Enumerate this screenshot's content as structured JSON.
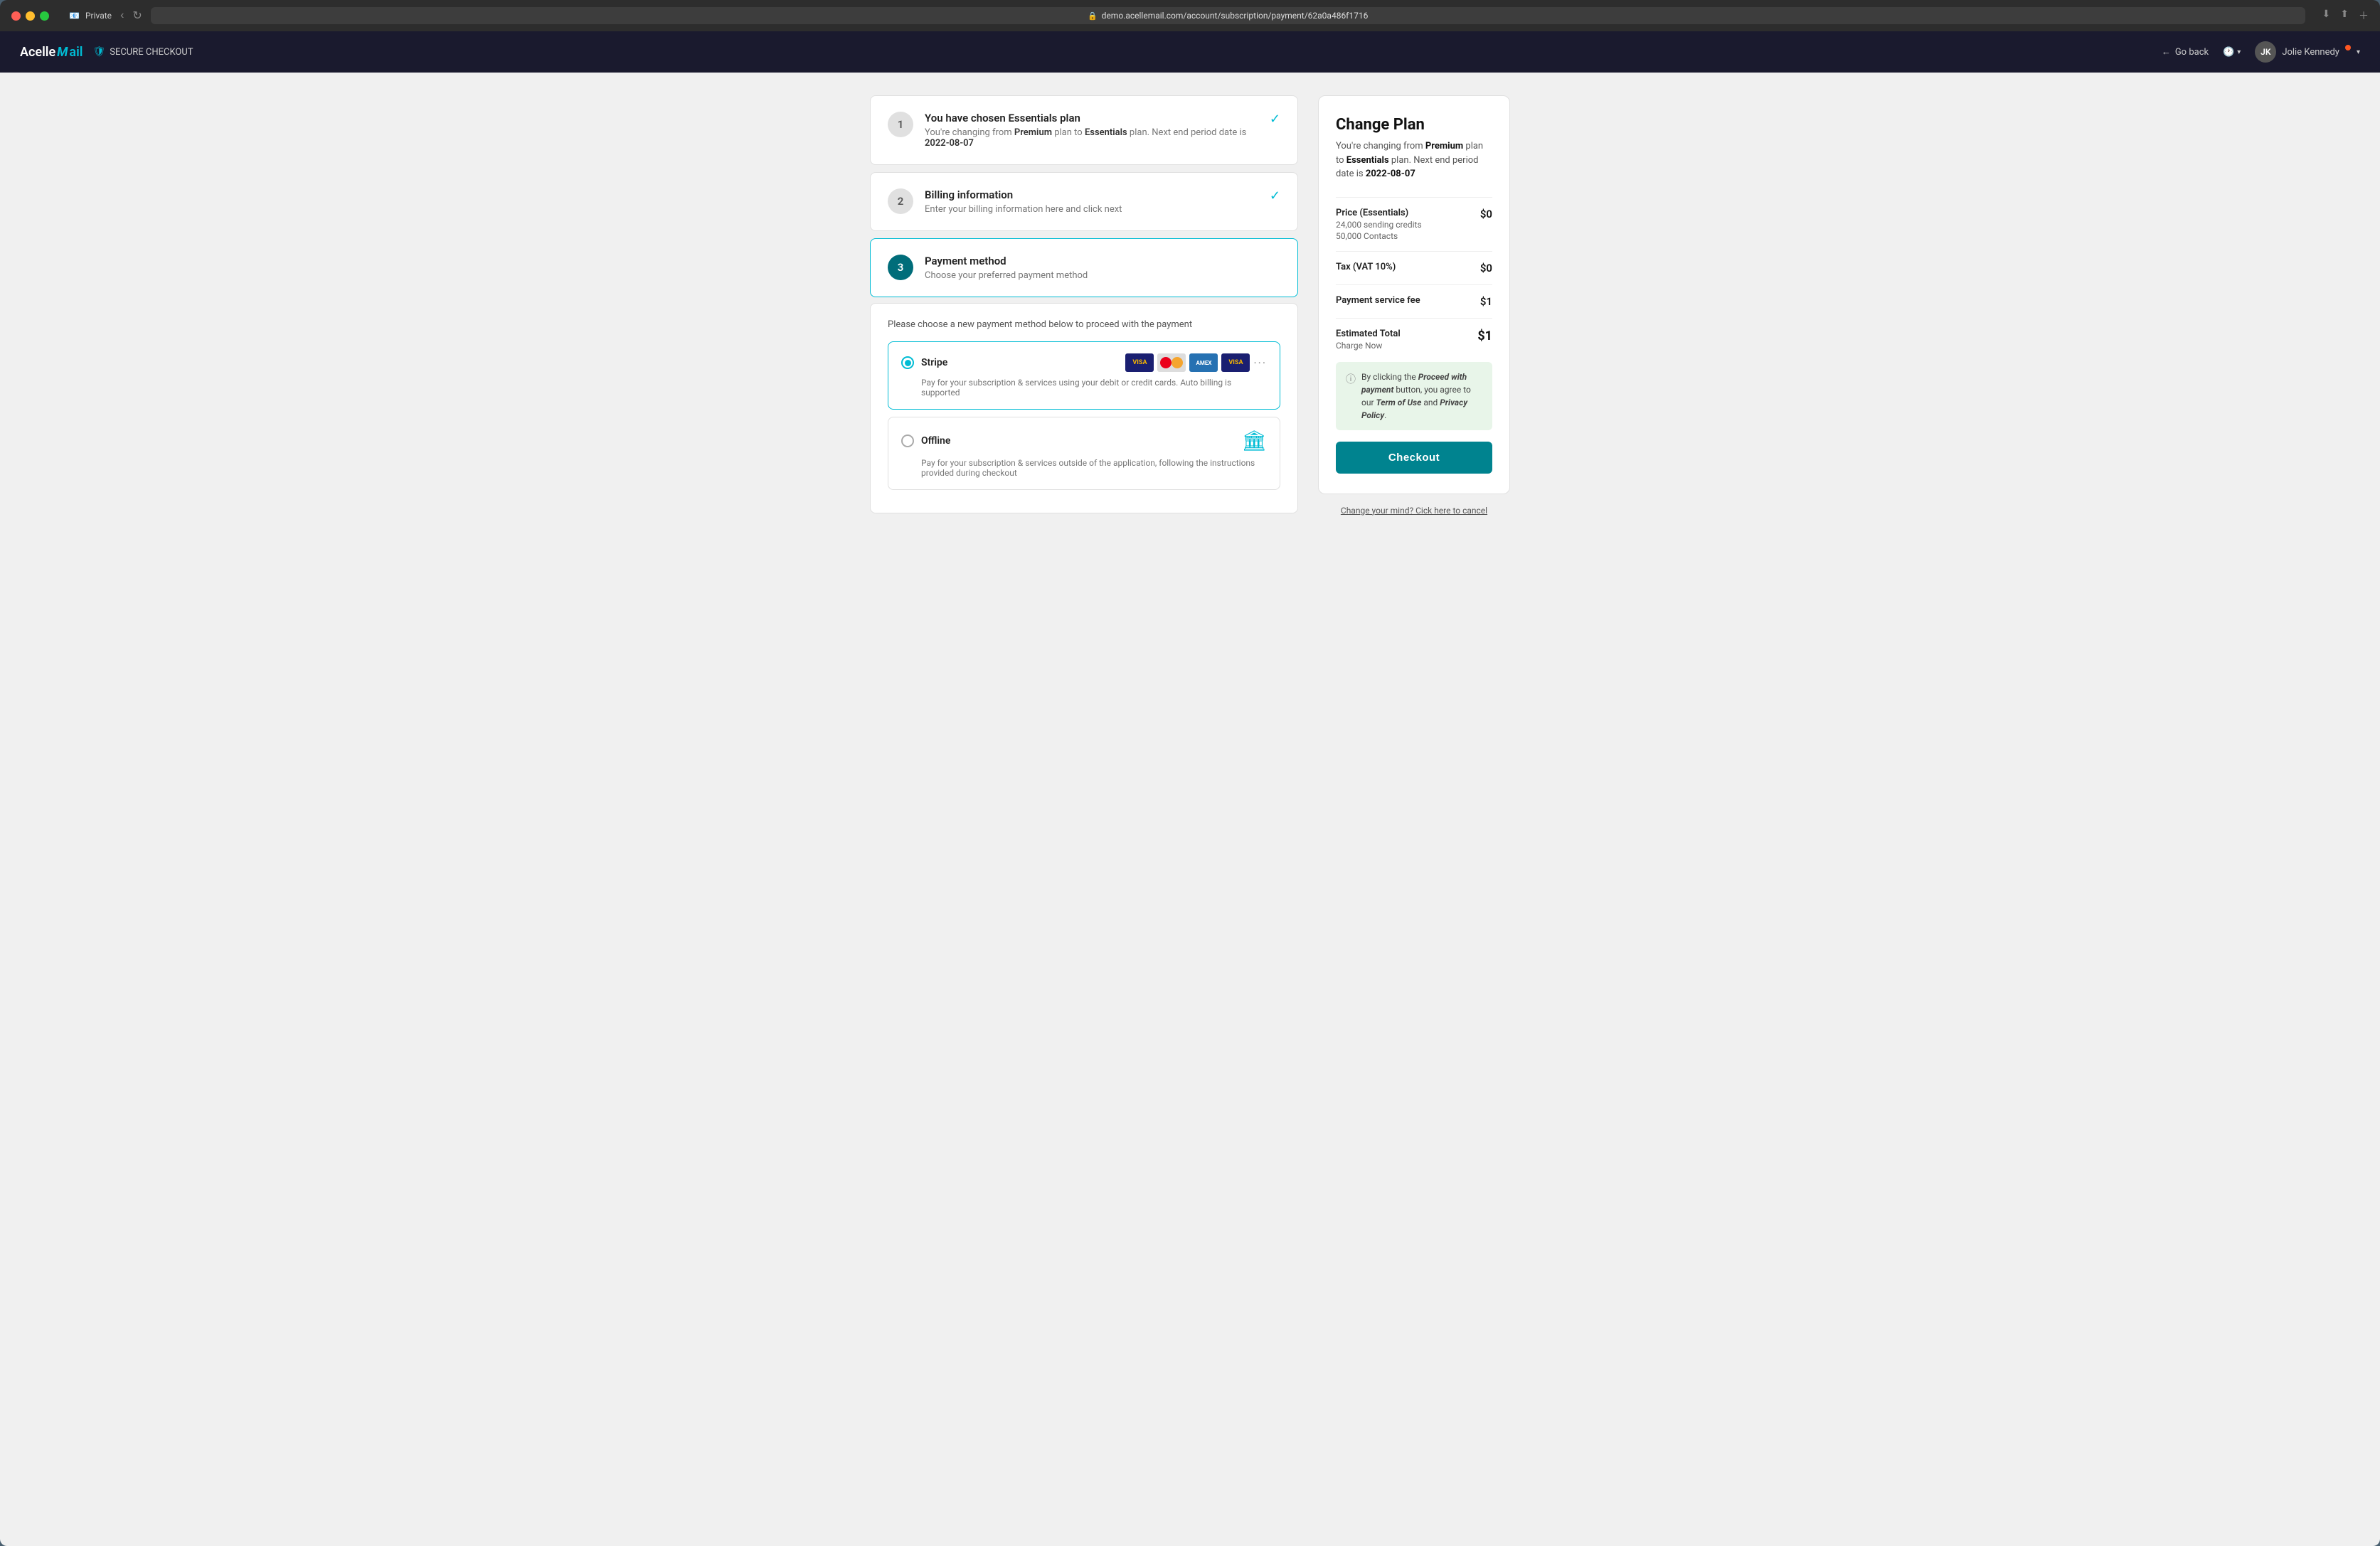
{
  "browser": {
    "tab_icon": "📧",
    "tab_label": "Private",
    "url": "demo.acellemail.com/account/subscription/payment/62a0a486f1716",
    "back_button": "←",
    "reload_button": "↻"
  },
  "header": {
    "logo_acelle": "Acelle",
    "logo_mail": "Mail",
    "secure_label": "SECURE CHECKOUT",
    "go_back_label": "Go back",
    "user_name": "Jolie Kennedy"
  },
  "steps": [
    {
      "number": "1",
      "title": "You have chosen Essentials plan",
      "subtitle_html": "You're changing from <strong>Premium</strong> plan to <strong>Essentials</strong> plan. Next end period date is <strong>2022-08-07</strong>",
      "active": false,
      "checked": true
    },
    {
      "number": "2",
      "title": "Billing information",
      "subtitle": "Enter your billing information here and click next",
      "active": false,
      "checked": true
    },
    {
      "number": "3",
      "title": "Payment method",
      "subtitle": "Choose your preferred payment method",
      "active": true,
      "checked": false
    }
  ],
  "payment_section": {
    "hint": "Please choose a new payment method below to proceed with the payment",
    "methods": [
      {
        "id": "stripe",
        "name": "Stripe",
        "description": "Pay for your subscription & services using your debit or credit cards. Auto billing is supported",
        "selected": true,
        "cards": [
          "VISA",
          "MC",
          "AMEX",
          "VISA"
        ]
      },
      {
        "id": "offline",
        "name": "Offline",
        "description": "Pay for your subscription & services outside of the application, following the instructions provided during checkout",
        "selected": false
      }
    ]
  },
  "summary": {
    "title": "Change Plan",
    "description_html": "You're changing from <strong>Premium</strong> plan to <strong>Essentials</strong> plan. Next end period date is <strong>2022-08-07</strong>",
    "price_label": "Price (Essentials)",
    "price_value": "$0",
    "price_sub1": "24,000 sending credits",
    "price_sub2": "50,000 Contacts",
    "tax_label": "Tax (VAT 10%)",
    "tax_value": "$0",
    "fee_label": "Payment service fee",
    "fee_value": "$1",
    "total_label": "Estimated Total",
    "total_sub": "Charge Now",
    "total_value": "$1",
    "info_text_html": "By clicking the <strong>Proceed with payment</strong> button, you agree to our <em>Term of Use</em> and <em>Privacy Policy</em>.",
    "checkout_label": "Checkout",
    "cancel_label": "Change your mind? Cick here to cancel"
  }
}
